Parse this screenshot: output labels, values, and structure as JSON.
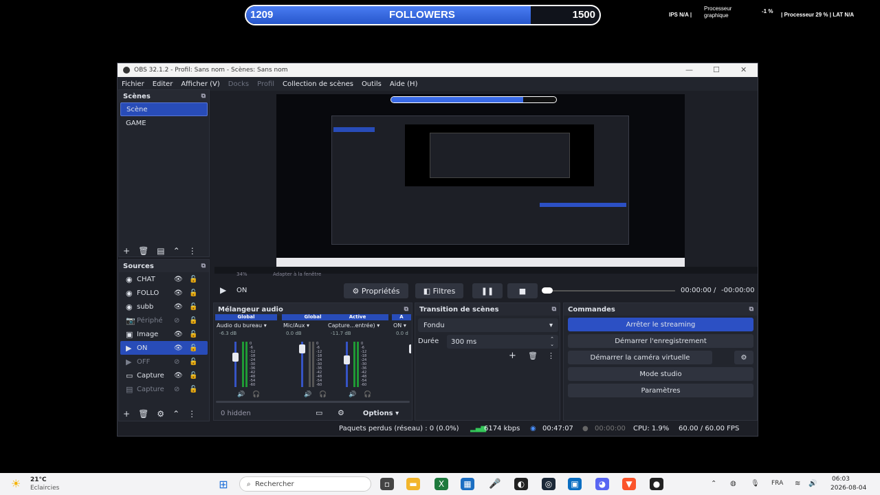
{
  "overlay": {
    "current": "1209",
    "label": "FOLLOWERS",
    "goal": "1500",
    "progress_fraction": 0.806
  },
  "perf": {
    "ips_label": "IPS",
    "ips_value": "N/A",
    "cpu_gfx_label": "Processeur\ngraphique",
    "delta": "-1 %",
    "cpu_label": "Processeur",
    "cpu_value": "29 %",
    "lat_label": "LAT",
    "lat_value": "N/A"
  },
  "window": {
    "title": "OBS 32.1.2 - Profil: Sans nom - Scènes: Sans nom"
  },
  "menu": [
    "Fichier",
    "Editer",
    "Afficher (V)",
    "Docks",
    "Profil",
    "Collection de scènes",
    "Outils",
    "Aide (H)"
  ],
  "scenes": {
    "title": "Scènes",
    "items": [
      "Scène",
      "GAME"
    ]
  },
  "sources": {
    "title": "Sources",
    "items": [
      "CHAT",
      "FOLLO",
      "subb",
      "Périphé",
      "Image",
      "ON",
      "OFF",
      "Capture",
      "Capture"
    ]
  },
  "preview": {
    "zoom": "34%",
    "fit": "Adapter à la fenêtre"
  },
  "controls": {
    "source_name": "ON",
    "properties": "Propriétés",
    "filters": "Filtres",
    "time": "00:00:00",
    "sep": "/",
    "remaining": "-00:00:00"
  },
  "mixer": {
    "title": "Mélangeur audio",
    "channels": [
      {
        "header": "Global",
        "name": "Audio du bureau",
        "db": "-6.3 dB"
      },
      {
        "header": "Global",
        "name": "Mic/Aux",
        "db": "0.0 dB"
      },
      {
        "header": "Active",
        "name": "Capture...entrée)",
        "db": "-11.7 dB"
      },
      {
        "header": "A",
        "name": "ON",
        "db": "0.0 d"
      }
    ],
    "scale": [
      "0",
      "-6",
      "-12",
      "-18",
      "-24",
      "-30",
      "-36",
      "-42",
      "-48",
      "-54",
      "-60"
    ],
    "hidden": "0 hidden",
    "options": "Options"
  },
  "transition": {
    "title": "Transition de scènes",
    "type": "Fondu",
    "duration_label": "Durée",
    "duration": "300 ms"
  },
  "commands": {
    "title": "Commandes",
    "buttons": [
      "Arrêter le streaming",
      "Démarrer l'enregistrement",
      "Démarrer la caméra virtuelle",
      "Mode studio",
      "Paramètres"
    ]
  },
  "status": {
    "dropped": "Paquets perdus (réseau) : 0 (0.0%)",
    "bitrate": "6174 kbps",
    "stream_time": "00:47:07",
    "rec_time": "00:00:00",
    "cpu": "CPU: 1.9%",
    "fps": "60.00 / 60.00 FPS"
  },
  "taskbar": {
    "temp": "21°C",
    "weather": "Eclaircies",
    "search": "Rechercher",
    "lang": "FRA",
    "time": "06:03",
    "date": "2026-08-04"
  },
  "colors": {
    "accent": "#284cb8",
    "bar_fill": "#3a6ae6",
    "panel": "#22252d"
  }
}
